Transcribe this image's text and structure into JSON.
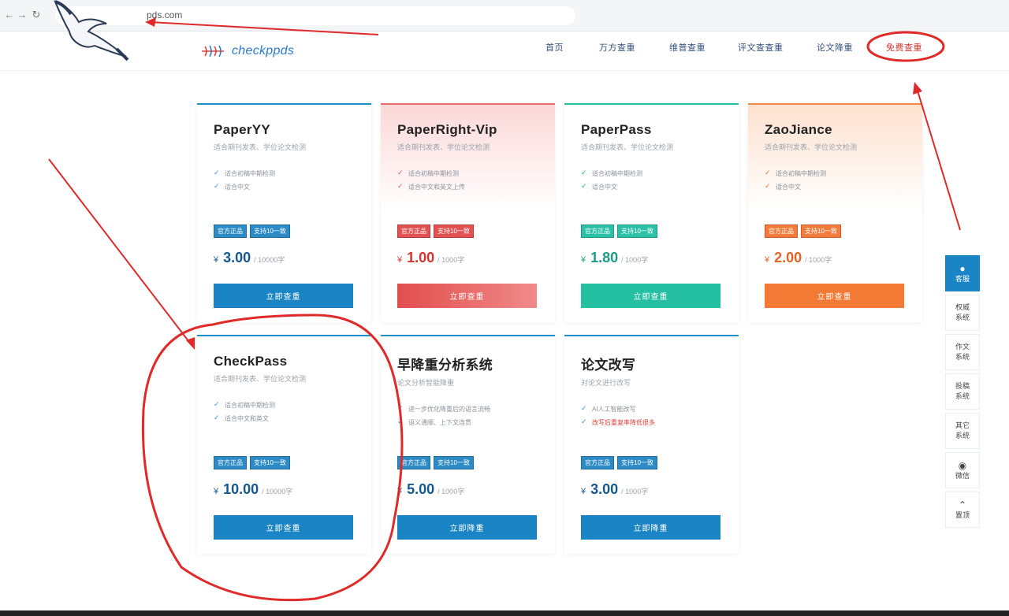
{
  "browser": {
    "back_icon": "back-arrow-icon",
    "forward_icon": "forward-arrow-icon",
    "reload_icon": "reload-icon",
    "address": "pds.com"
  },
  "header": {
    "brand": "checkppds",
    "nav": [
      {
        "label": "首页"
      },
      {
        "label": "万方查重"
      },
      {
        "label": "维普查重"
      },
      {
        "label": "评文查查重"
      },
      {
        "label": "论文降重"
      },
      {
        "label": "免费查重"
      }
    ]
  },
  "cards": [
    {
      "title": "PaperYY",
      "subtitle": "适合期刊发表、学位论文检测",
      "features": [
        "适合初稿中期检测",
        "适合中文"
      ],
      "tags": [
        "官方正品",
        "支持10一致"
      ],
      "currency": "¥",
      "price": "3.00",
      "unit": "/ 10000字",
      "button": "立即查重",
      "theme": "blue"
    },
    {
      "title": "PaperRight-Vip",
      "subtitle": "适合期刊发表、学位论文检测",
      "features": [
        "适合初稿中期检测",
        "适合中文和英文上传"
      ],
      "tags": [
        "官方正品",
        "支持10一致"
      ],
      "currency": "¥",
      "price": "1.00",
      "unit": "/ 1000字",
      "button": "立即查重",
      "theme": "red"
    },
    {
      "title": "PaperPass",
      "subtitle": "适合期刊发表、学位论文检测",
      "features": [
        "适合初稿中期检测",
        "适合中文"
      ],
      "tags": [
        "官方正品",
        "支持10一致"
      ],
      "currency": "¥",
      "price": "1.80",
      "unit": "/ 1000字",
      "button": "立即查重",
      "theme": "teal"
    },
    {
      "title": "ZaoJiance",
      "subtitle": "适合期刊发表、学位论文检测",
      "features": [
        "适合初稿中期检测",
        "适合中文"
      ],
      "tags": [
        "官方正品",
        "支持10一致"
      ],
      "currency": "¥",
      "price": "2.00",
      "unit": "/ 1000字",
      "button": "立即查重",
      "theme": "orange"
    },
    {
      "title": "CheckPass",
      "subtitle": "适合期刊发表、学位论文检测",
      "features": [
        "适合初稿中期检测",
        "适合中文和英文"
      ],
      "tags": [
        "官方正品",
        "支持10一致"
      ],
      "currency": "¥",
      "price": "10.00",
      "unit": "/ 10000字",
      "button": "立即查重",
      "theme": "blue"
    },
    {
      "title": "早降重分析系统",
      "subtitle": "论文分析智能降重",
      "features": [
        "进一步优化降重后的语言流畅",
        "语义通顺、上下文连贯"
      ],
      "tags": [
        "官方正品",
        "支持10一致"
      ],
      "currency": "¥",
      "price": "5.00",
      "unit": "/ 1000字",
      "button": "立即降重",
      "theme": "blue"
    },
    {
      "title": "论文改写",
      "subtitle": "对论文进行改写",
      "features": [
        "AI人工智能改写",
        "改写后重复率降低很多"
      ],
      "tags": [
        "官方正品",
        "支持10一致"
      ],
      "currency": "¥",
      "price": "3.00",
      "unit": "/ 1000字",
      "button": "立即降重",
      "theme": "blue"
    }
  ],
  "side": [
    {
      "icon": "qq-icon",
      "label": "客服"
    },
    {
      "icon": "",
      "label": "权威系统"
    },
    {
      "icon": "",
      "label": "作文系统"
    },
    {
      "icon": "",
      "label": "投稿系统"
    },
    {
      "icon": "",
      "label": "其它系统"
    },
    {
      "icon": "wechat-icon",
      "label": "微信"
    },
    {
      "icon": "back-to-top-icon",
      "label": "置顶"
    }
  ],
  "colors": {
    "blue": "#1b84c4",
    "red": "#e24e4e",
    "teal": "#25bfa2",
    "orange": "#f37a35",
    "annotation": "#e02a2a"
  }
}
